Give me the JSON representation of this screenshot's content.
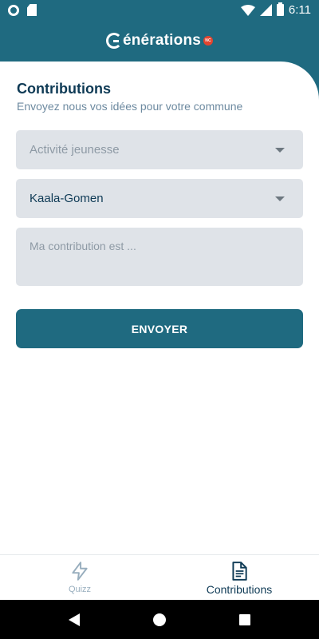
{
  "status_bar": {
    "time": "6:11"
  },
  "header": {
    "brand": "énérations",
    "badge": "NC"
  },
  "form": {
    "title": "Contributions",
    "subtitle": "Envoyez nous vos idées pour votre commune",
    "category_select": {
      "placeholder": "Activité jeunesse"
    },
    "commune_select": {
      "value": "Kaala-Gomen"
    },
    "contribution_field": {
      "placeholder": "Ma contribution est ..."
    },
    "submit_label": "ENVOYER"
  },
  "bottom_nav": {
    "items": [
      {
        "label": "Quizz",
        "icon": "lightning-icon",
        "active": false
      },
      {
        "label": "Contributions",
        "icon": "document-icon",
        "active": true
      }
    ]
  },
  "colors": {
    "primary": "#1f6a80",
    "title": "#0e3a55",
    "field_bg": "#dfe3e8",
    "badge": "#e2452f"
  }
}
